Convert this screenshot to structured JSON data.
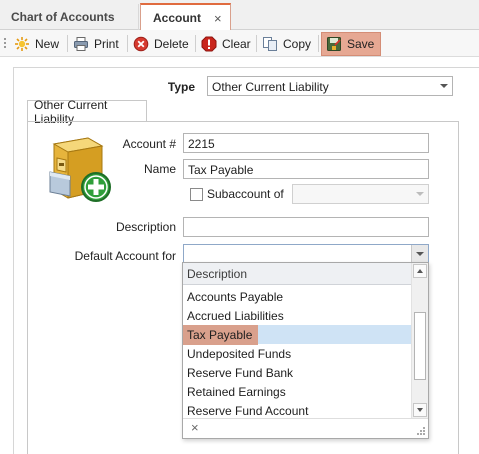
{
  "tabs": [
    {
      "label": "Chart of Accounts",
      "active": false
    },
    {
      "label": "Account",
      "active": true,
      "close_glyph": "×"
    }
  ],
  "toolbar": {
    "new_label": "New",
    "print_label": "Print",
    "delete_label": "Delete",
    "clear_label": "Clear",
    "copy_label": "Copy",
    "save_label": "Save",
    "icons": [
      "sun-new-icon",
      "printer-icon",
      "delete-icon",
      "clear-icon",
      "copy-icon",
      "save-icon"
    ]
  },
  "form": {
    "type_label": "Type",
    "type_value": "Other Current Liability",
    "group_tab_label": "Other Current Liability",
    "account_num_label": "Account #",
    "account_num_value": "2215",
    "name_label": "Name",
    "name_value": "Tax Payable",
    "subaccount_label": "Subaccount of",
    "subaccount_checked": false,
    "subaccount_value": "",
    "description_label": "Description",
    "description_value": "",
    "default_account_label": "Default Account for",
    "default_account_value": ""
  },
  "dropdown": {
    "header": "Description",
    "items": [
      "Accounts Payable",
      "Accrued Liabilities",
      "Tax Payable",
      "Undeposited Funds",
      "Reserve Fund Bank",
      "Retained Earnings",
      "Reserve Fund Account"
    ],
    "selected_index": 2,
    "close_glyph": "×"
  },
  "colors": {
    "active_tab_accent": "#e06b3f",
    "save_highlight": "#e6a893",
    "selected_row": "#cfe3f5",
    "selected_text_highlight": "#d9a08c"
  }
}
